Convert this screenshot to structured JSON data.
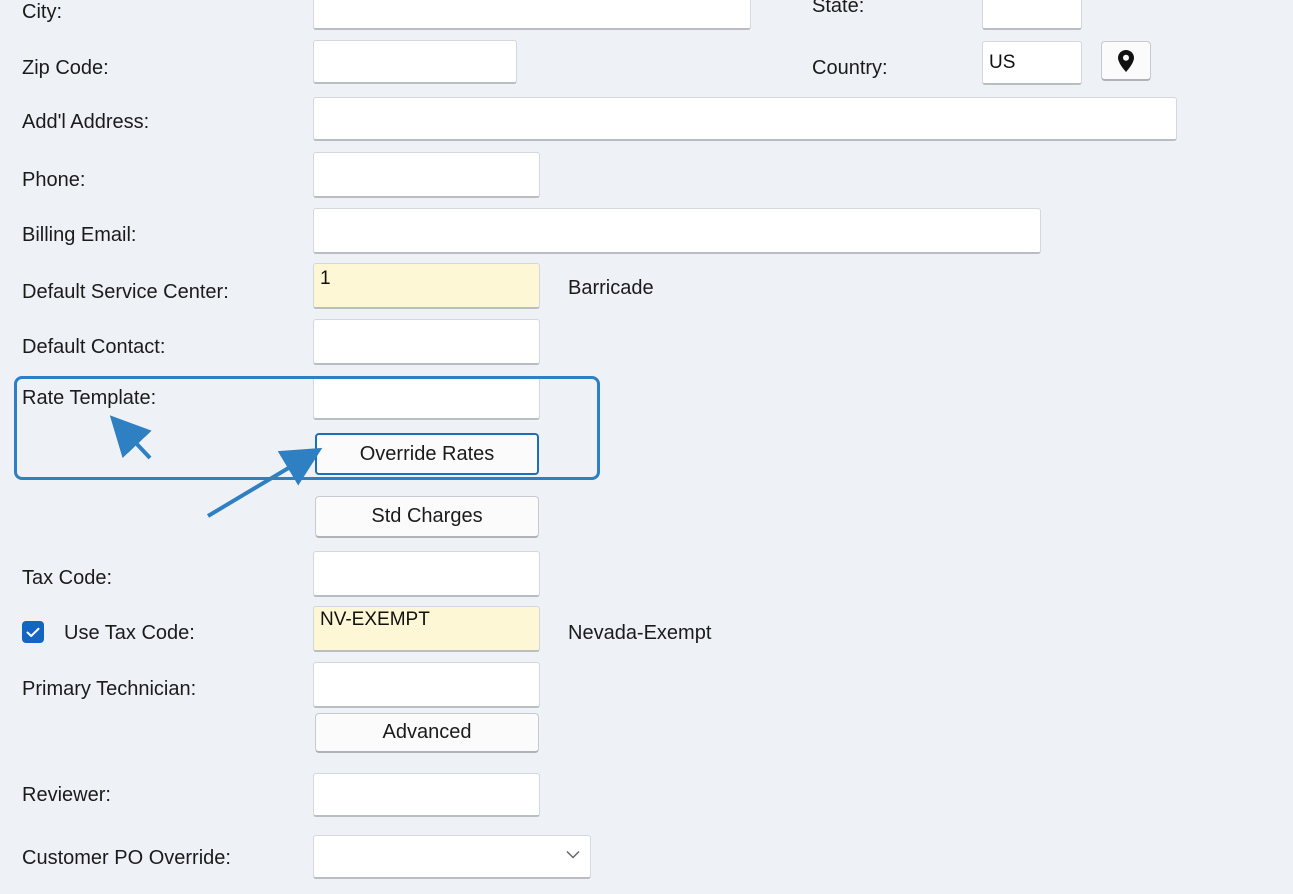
{
  "form": {
    "city": {
      "label": "City:",
      "value": ""
    },
    "state": {
      "label": "State:",
      "value": ""
    },
    "zip": {
      "label": "Zip Code:",
      "value": ""
    },
    "country": {
      "label": "Country:",
      "value": "US"
    },
    "addl_address": {
      "label": "Add'l Address:",
      "value": ""
    },
    "phone": {
      "label": "Phone:",
      "value": ""
    },
    "billing_email": {
      "label": "Billing Email:",
      "value": ""
    },
    "default_service_center": {
      "label": "Default Service Center:",
      "value": "1",
      "description": "Barricade"
    },
    "default_contact": {
      "label": "Default Contact:",
      "value": ""
    },
    "rate_template": {
      "label": "Rate Template:",
      "value": ""
    },
    "override_rates_button": "Override Rates",
    "std_charges_button": "Std Charges",
    "tax_code": {
      "label": "Tax Code:",
      "value": ""
    },
    "use_tax_code": {
      "label": "Use Tax Code:",
      "checked": true,
      "value": "NV-EXEMPT",
      "description": "Nevada-Exempt"
    },
    "primary_technician": {
      "label": "Primary Technician:",
      "value": ""
    },
    "advanced_button": "Advanced",
    "reviewer": {
      "label": "Reviewer:",
      "value": ""
    },
    "customer_po_override": {
      "label": "Customer PO Override:",
      "value": ""
    }
  },
  "icons": {
    "map_pin": "map-pin-icon",
    "checkbox_check": "checkmark-icon",
    "dropdown": "chevron-down-icon"
  },
  "colors": {
    "background": "#eef2f6",
    "highlight_field": "#fdf7d6",
    "accent": "#1266c2",
    "annotation": "#2f7fc3"
  }
}
